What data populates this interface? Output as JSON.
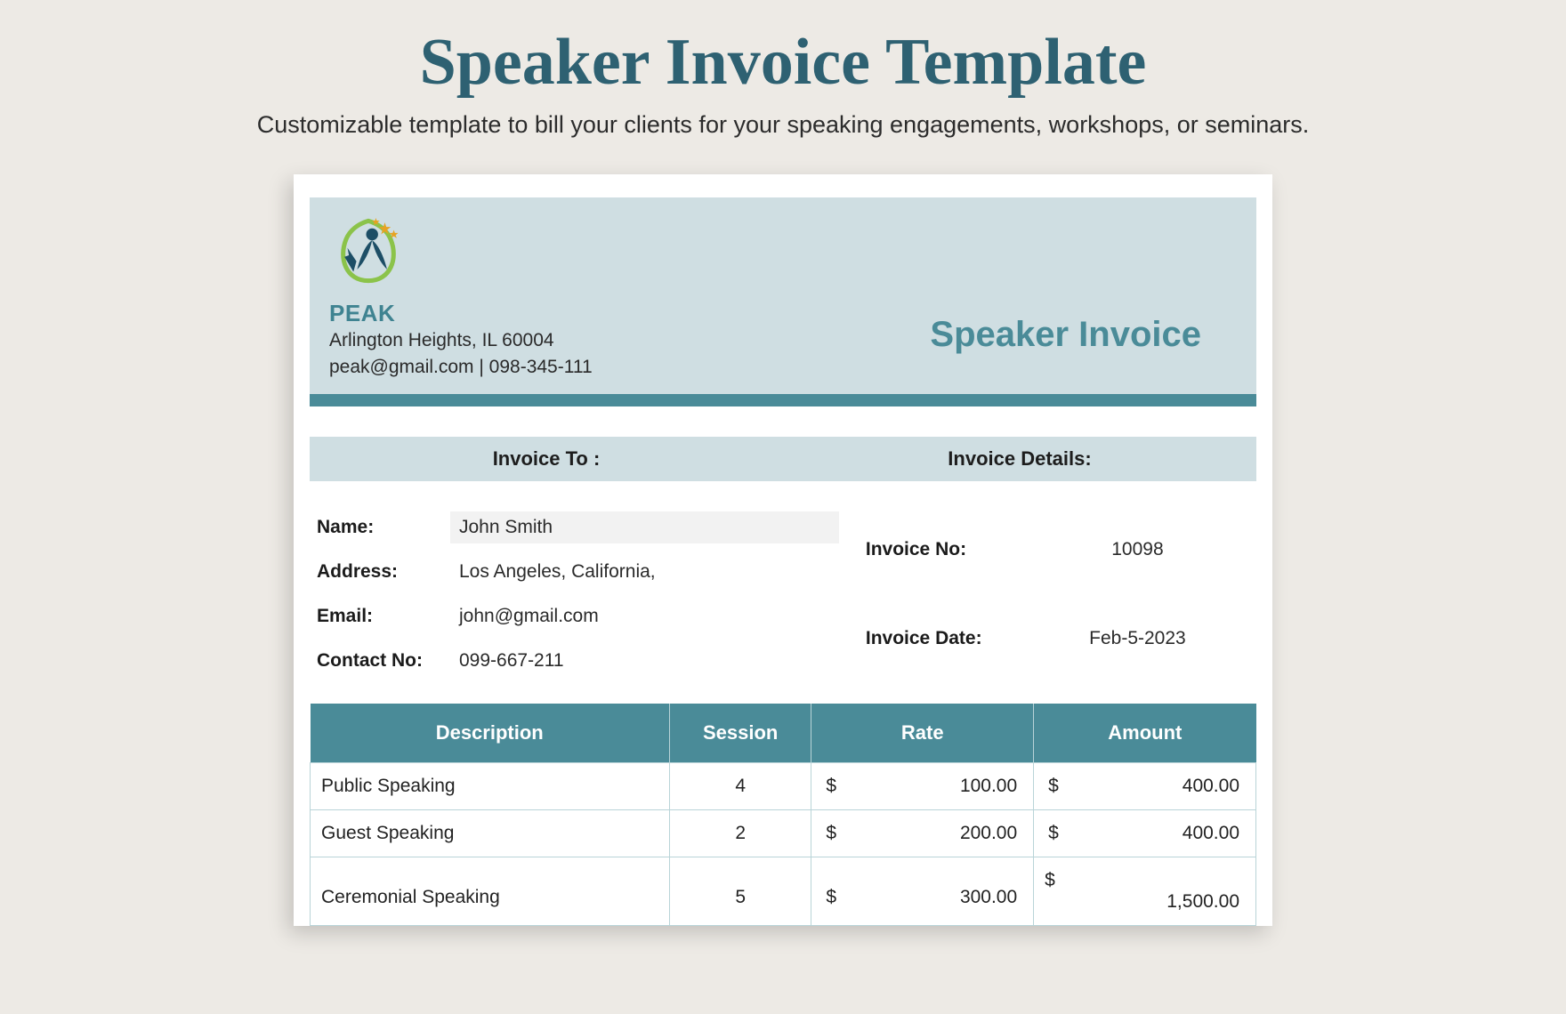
{
  "page": {
    "title": "Speaker Invoice Template",
    "subtitle": "Customizable template to bill your clients for your speaking engagements, workshops, or seminars."
  },
  "company": {
    "name": "PEAK",
    "address": "Arlington Heights, IL 60004",
    "contact": "peak@gmail.com | 098-345-111"
  },
  "invoice_header": "Speaker Invoice",
  "section_heads": {
    "to": "Invoice To :",
    "details": "Invoice Details:"
  },
  "to": {
    "name_label": "Name:",
    "name": "John Smith",
    "address_label": "Address:",
    "address": "Los Angeles, California,",
    "email_label": "Email:",
    "email": "john@gmail.com",
    "contact_label": "Contact No:",
    "contact": "099-667-211"
  },
  "details": {
    "no_label": "Invoice No:",
    "no": "10098",
    "date_label": "Invoice Date:",
    "date": "Feb-5-2023"
  },
  "table": {
    "headers": {
      "description": "Description",
      "session": "Session",
      "rate": "Rate",
      "amount": "Amount"
    },
    "currency": "$",
    "rows": [
      {
        "description": "Public Speaking",
        "session": "4",
        "rate": "100.00",
        "amount": "400.00"
      },
      {
        "description": "Guest Speaking",
        "session": "2",
        "rate": "200.00",
        "amount": "400.00"
      },
      {
        "description": "Ceremonial Speaking",
        "session": "5",
        "rate": "300.00",
        "amount": "1,500.00"
      }
    ]
  }
}
